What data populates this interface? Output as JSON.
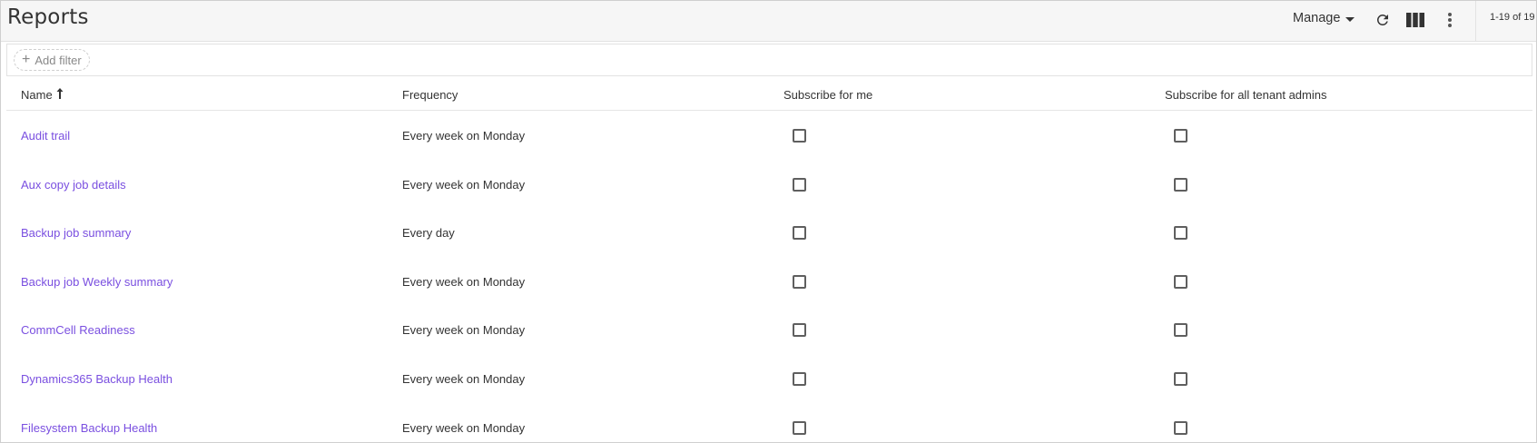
{
  "header": {
    "title": "Reports",
    "manage_label": "Manage",
    "paging": "1-19 of 19"
  },
  "filter": {
    "add_filter_label": "Add filter"
  },
  "table": {
    "columns": [
      "Name",
      "Frequency",
      "Subscribe for me",
      "Subscribe for all tenant admins"
    ],
    "sort_column": "Name",
    "sort_direction": "ascending",
    "rows": [
      {
        "name": "Audit trail",
        "frequency": "Every week on Monday",
        "subscribe_me": false,
        "subscribe_all": false
      },
      {
        "name": "Aux copy job details",
        "frequency": "Every week on Monday",
        "subscribe_me": false,
        "subscribe_all": false
      },
      {
        "name": "Backup job summary",
        "frequency": "Every day",
        "subscribe_me": false,
        "subscribe_all": false
      },
      {
        "name": "Backup job Weekly summary",
        "frequency": "Every week on Monday",
        "subscribe_me": false,
        "subscribe_all": false
      },
      {
        "name": "CommCell Readiness",
        "frequency": "Every week on Monday",
        "subscribe_me": false,
        "subscribe_all": false
      },
      {
        "name": "Dynamics365 Backup Health",
        "frequency": "Every week on Monday",
        "subscribe_me": false,
        "subscribe_all": false
      },
      {
        "name": "Filesystem Backup Health",
        "frequency": "Every week on Monday",
        "subscribe_me": false,
        "subscribe_all": false
      }
    ]
  },
  "icons": {
    "refresh": "refresh-icon",
    "columns": "columns-icon",
    "more": "more-vertical-icon",
    "sort": "sort-ascending-icon",
    "add": "plus-icon"
  },
  "colors": {
    "link": "#7a4fe0",
    "header_bg": "#f6f6f6"
  }
}
